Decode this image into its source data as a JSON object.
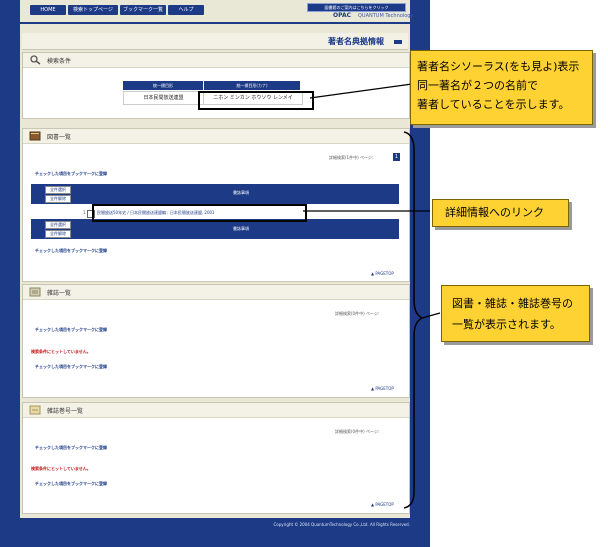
{
  "nav": {
    "tabs": [
      "HOME",
      "検索トップページ",
      "ブックマーク一覧",
      "ヘルプ"
    ],
    "brand_box": "図書館のご案内はこちらをクリック",
    "opac": "OPAC",
    "opac_by": "QUANTUM Technology"
  },
  "page": {
    "title": "著者名典拠情報"
  },
  "conditions": {
    "label": "検索条件",
    "col1_header": "統一標目形",
    "col2_header": "統一標目形(カナ)",
    "col1_value": "日本民間放送連盟",
    "col2_value": "ニホン ミンカン ホウソウ レンメイ"
  },
  "books": {
    "label": "図書一覧",
    "pager": "詳細検索(1件中) ページ:",
    "page_num": "1",
    "bookmark_link": "チェックした項目をブックマークに登録",
    "select_all": "全件選択",
    "clear_all": "全件解除",
    "col_header": "書誌事項",
    "row_no": "1",
    "row_text": "民間放送50年史 / 日本民間放送連盟編 ; 日本民間放送連盟, 2001",
    "pagetop": "▲ PAGETOP"
  },
  "journals": {
    "label": "雑誌一覧",
    "pager": "詳細検索(0件中) ページ:",
    "bookmark_link": "チェックした項目をブックマークに登録",
    "none_msg": "検索条件にヒットしていません。",
    "pagetop": "▲ PAGETOP"
  },
  "volumes": {
    "label": "雑誌巻号一覧",
    "pager": "詳細検索(0件中) ページ:",
    "bookmark_link": "チェックした項目をブックマークに登録",
    "none_msg": "検索条件にヒットしていません。",
    "pagetop": "▲ PAGETOP"
  },
  "footer": {
    "copyright": "Copyright © 2004 QuantumTechnology Co.,Ltd. All Rights Reserved."
  },
  "callouts": {
    "top": [
      "著者名シソーラス(をも見よ)表示",
      "同一著名が２つの名前で",
      "著者していることを示します。"
    ],
    "link": "詳細情報へのリンク",
    "lists": [
      "図書・雑誌・雑誌巻号の",
      "一覧が表示されます。"
    ]
  },
  "colors": {
    "navy": "#1c3a85",
    "callout": "#ffd233",
    "alert": "#c8121a"
  }
}
